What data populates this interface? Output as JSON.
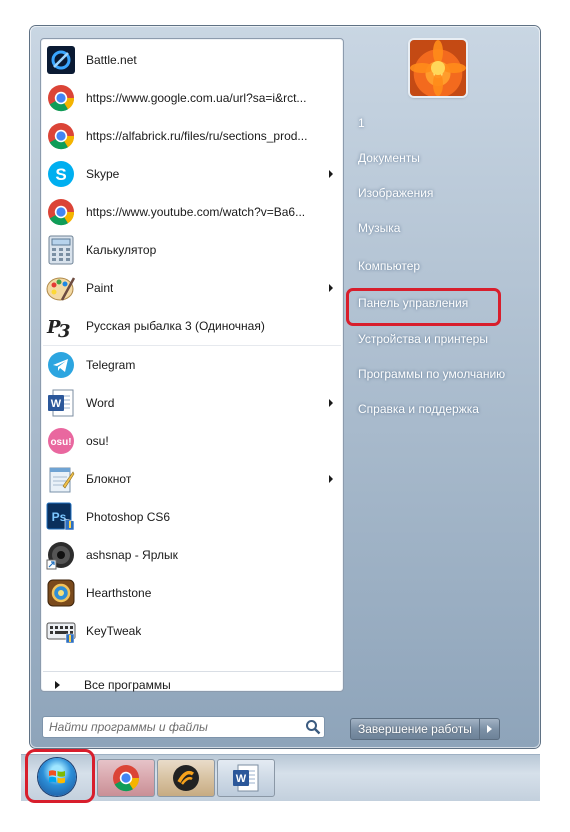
{
  "programs": [
    {
      "label": "Battle.net",
      "icon": "battlenet-icon",
      "submenu": false
    },
    {
      "label": "https://www.google.com.ua/url?sa=i&rct...",
      "icon": "chrome-icon",
      "submenu": false
    },
    {
      "label": "https://alfabrick.ru/files/ru/sections_prod...",
      "icon": "chrome-icon",
      "submenu": false
    },
    {
      "label": "Skype",
      "icon": "skype-icon",
      "submenu": true
    },
    {
      "label": "https://www.youtube.com/watch?v=Ba6...",
      "icon": "chrome-icon",
      "submenu": false
    },
    {
      "label": "Калькулятор",
      "icon": "calculator-icon",
      "submenu": false
    },
    {
      "label": "Paint",
      "icon": "paint-icon",
      "submenu": true
    },
    {
      "label": "Русская рыбалка 3 (Одиночная)",
      "icon": "rr3-icon",
      "submenu": false
    },
    {
      "label": "Telegram",
      "icon": "telegram-icon",
      "submenu": false
    },
    {
      "label": "Word",
      "icon": "word-icon",
      "submenu": true
    },
    {
      "label": "osu!",
      "icon": "osu-icon",
      "submenu": false
    },
    {
      "label": "Блокнот",
      "icon": "notepad-icon",
      "submenu": true
    },
    {
      "label": "Photoshop CS6",
      "icon": "photoshop-icon",
      "submenu": false
    },
    {
      "label": "ashsnap - Ярлык",
      "icon": "ashsnap-icon",
      "submenu": false
    },
    {
      "label": "Hearthstone",
      "icon": "hearthstone-icon",
      "submenu": false
    },
    {
      "label": "KeyTweak",
      "icon": "keytweak-icon",
      "submenu": false
    }
  ],
  "all_programs_label": "Все программы",
  "search": {
    "placeholder": "Найти программы и файлы"
  },
  "right_pane": {
    "user_name": "1",
    "items": [
      {
        "label": "Документы"
      },
      {
        "label": "Изображения"
      },
      {
        "label": "Музыка"
      },
      {
        "label": "Компьютер"
      },
      {
        "label": "Панель управления"
      },
      {
        "label": "Устройства и принтеры"
      },
      {
        "label": "Программы по умолчанию"
      },
      {
        "label": "Справка и поддержка"
      }
    ]
  },
  "shutdown_label": "Завершение работы",
  "taskbar_items": [
    {
      "name": "chrome"
    },
    {
      "name": "media-player"
    },
    {
      "name": "word"
    }
  ],
  "colors": {
    "highlight": "#d81e2c",
    "menu_blue": "#8ea4ba"
  }
}
